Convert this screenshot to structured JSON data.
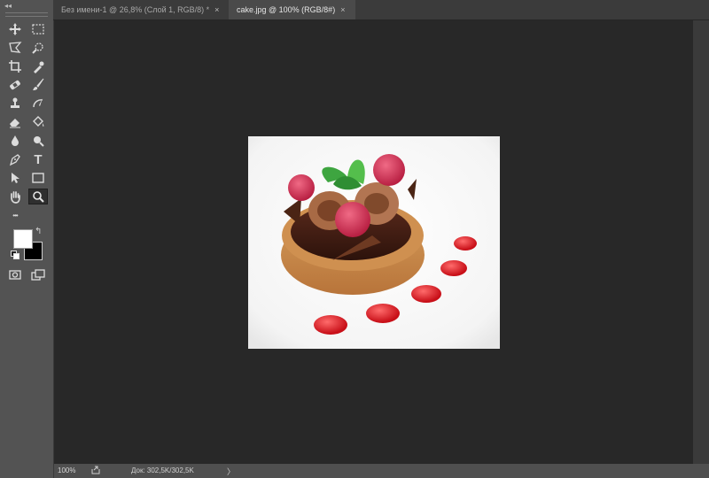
{
  "toolbar": {
    "collapse_glyph": "◂◂",
    "tools": [
      {
        "name": "move-tool",
        "icon": "move-icon"
      },
      {
        "name": "marquee-tool",
        "icon": "rect-marquee-icon"
      },
      {
        "name": "lasso-tool",
        "icon": "poly-lasso-icon"
      },
      {
        "name": "quick-select-tool",
        "icon": "quick-select-icon"
      },
      {
        "name": "crop-tool",
        "icon": "crop-icon"
      },
      {
        "name": "eyedropper-tool",
        "icon": "eyedropper-icon"
      },
      {
        "name": "healing-tool",
        "icon": "bandage-icon"
      },
      {
        "name": "brush-tool",
        "icon": "brush-icon"
      },
      {
        "name": "stamp-tool",
        "icon": "stamp-icon"
      },
      {
        "name": "history-brush-tool",
        "icon": "history-brush-icon"
      },
      {
        "name": "eraser-tool",
        "icon": "eraser-icon"
      },
      {
        "name": "paint-bucket-tool",
        "icon": "paint-bucket-icon"
      },
      {
        "name": "blur-tool",
        "icon": "drop-icon"
      },
      {
        "name": "dodge-tool",
        "icon": "dodge-icon"
      },
      {
        "name": "pen-tool",
        "icon": "pen-icon"
      },
      {
        "name": "type-tool",
        "icon": "type-icon",
        "glyph": "T"
      },
      {
        "name": "path-select-tool",
        "icon": "arrow-icon"
      },
      {
        "name": "shape-tool",
        "icon": "rectangle-icon"
      },
      {
        "name": "hand-tool",
        "icon": "hand-icon"
      },
      {
        "name": "zoom-tool",
        "icon": "zoom-icon"
      },
      {
        "name": "more-tools",
        "icon": "more-icon",
        "glyph": "•••"
      },
      {
        "name": "quick-mask",
        "icon": "quick-mask-icon"
      },
      {
        "name": "screen-mode",
        "icon": "screen-mode-icon"
      }
    ],
    "foreground_color": "#ffffff",
    "background_color": "#000000",
    "swap_glyph": "↰"
  },
  "tabs": [
    {
      "label": "Без имени-1 @ 26,8% (Слой 1, RGB/8) *",
      "close": "×",
      "active": false
    },
    {
      "label": "cake.jpg @ 100% (RGB/8#)",
      "close": "×",
      "active": true
    }
  ],
  "status": {
    "zoom": "100%",
    "doc_info": "Док: 302,5K/302,5K",
    "arrow": "〉"
  },
  "colors": {
    "app_bg": "#535353",
    "canvas_bg": "#282828",
    "tab_bar": "#3b3b3b",
    "active_tab": "#4a4a4a"
  }
}
